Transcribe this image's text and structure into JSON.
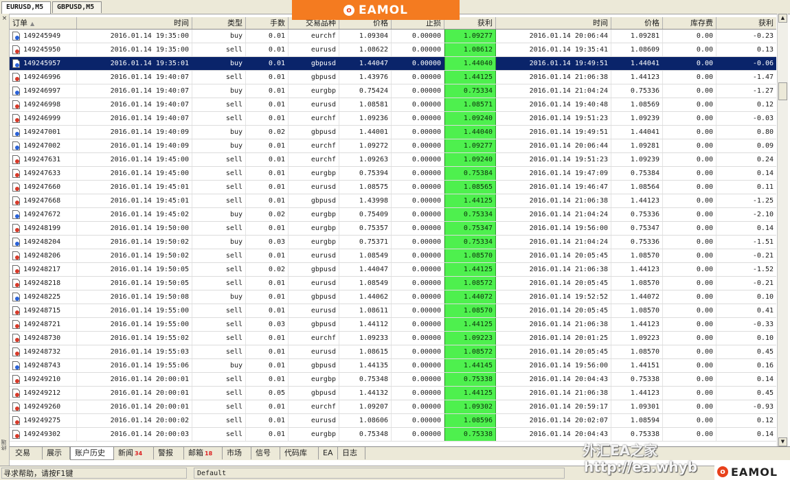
{
  "chart_tabs": [
    "EURUSD,M5",
    "GBPUSD,M5"
  ],
  "logo": {
    "text": "EAMOL",
    "mark": "o"
  },
  "left_strip": {
    "close": "×",
    "text": "终端"
  },
  "columns": [
    "订单",
    "时间",
    "类型",
    "手数",
    "交易品种",
    "价格",
    "止损",
    "获利",
    "时间",
    "价格",
    "库存费",
    "获利"
  ],
  "rows": [
    {
      "order": "149245949",
      "time": "2016.01.14 19:35:00",
      "type": "buy",
      "lots": "0.01",
      "symbol": "eurchf",
      "price": "1.09304",
      "sl": "0.00000",
      "tp": "1.09277",
      "close_time": "2016.01.14 20:06:44",
      "close_price": "1.09281",
      "swap": "0.00",
      "profit": "-0.23"
    },
    {
      "order": "149245950",
      "time": "2016.01.14 19:35:00",
      "type": "sell",
      "lots": "0.01",
      "symbol": "eurusd",
      "price": "1.08622",
      "sl": "0.00000",
      "tp": "1.08612",
      "close_time": "2016.01.14 19:35:41",
      "close_price": "1.08609",
      "swap": "0.00",
      "profit": "0.13"
    },
    {
      "order": "149245957",
      "time": "2016.01.14 19:35:01",
      "type": "buy",
      "lots": "0.01",
      "symbol": "gbpusd",
      "price": "1.44047",
      "sl": "0.00000",
      "tp": "1.44040",
      "close_time": "2016.01.14 19:49:51",
      "close_price": "1.44041",
      "swap": "0.00",
      "profit": "-0.06",
      "selected": true
    },
    {
      "order": "149246996",
      "time": "2016.01.14 19:40:07",
      "type": "sell",
      "lots": "0.01",
      "symbol": "gbpusd",
      "price": "1.43976",
      "sl": "0.00000",
      "tp": "1.44125",
      "close_time": "2016.01.14 21:06:38",
      "close_price": "1.44123",
      "swap": "0.00",
      "profit": "-1.47"
    },
    {
      "order": "149246997",
      "time": "2016.01.14 19:40:07",
      "type": "buy",
      "lots": "0.01",
      "symbol": "eurgbp",
      "price": "0.75424",
      "sl": "0.00000",
      "tp": "0.75334",
      "close_time": "2016.01.14 21:04:24",
      "close_price": "0.75336",
      "swap": "0.00",
      "profit": "-1.27"
    },
    {
      "order": "149246998",
      "time": "2016.01.14 19:40:07",
      "type": "sell",
      "lots": "0.01",
      "symbol": "eurusd",
      "price": "1.08581",
      "sl": "0.00000",
      "tp": "1.08571",
      "close_time": "2016.01.14 19:40:48",
      "close_price": "1.08569",
      "swap": "0.00",
      "profit": "0.12"
    },
    {
      "order": "149246999",
      "time": "2016.01.14 19:40:07",
      "type": "sell",
      "lots": "0.01",
      "symbol": "eurchf",
      "price": "1.09236",
      "sl": "0.00000",
      "tp": "1.09240",
      "close_time": "2016.01.14 19:51:23",
      "close_price": "1.09239",
      "swap": "0.00",
      "profit": "-0.03"
    },
    {
      "order": "149247001",
      "time": "2016.01.14 19:40:09",
      "type": "buy",
      "lots": "0.02",
      "symbol": "gbpusd",
      "price": "1.44001",
      "sl": "0.00000",
      "tp": "1.44040",
      "close_time": "2016.01.14 19:49:51",
      "close_price": "1.44041",
      "swap": "0.00",
      "profit": "0.80"
    },
    {
      "order": "149247002",
      "time": "2016.01.14 19:40:09",
      "type": "buy",
      "lots": "0.01",
      "symbol": "eurchf",
      "price": "1.09272",
      "sl": "0.00000",
      "tp": "1.09277",
      "close_time": "2016.01.14 20:06:44",
      "close_price": "1.09281",
      "swap": "0.00",
      "profit": "0.09"
    },
    {
      "order": "149247631",
      "time": "2016.01.14 19:45:00",
      "type": "sell",
      "lots": "0.01",
      "symbol": "eurchf",
      "price": "1.09263",
      "sl": "0.00000",
      "tp": "1.09240",
      "close_time": "2016.01.14 19:51:23",
      "close_price": "1.09239",
      "swap": "0.00",
      "profit": "0.24"
    },
    {
      "order": "149247633",
      "time": "2016.01.14 19:45:00",
      "type": "sell",
      "lots": "0.01",
      "symbol": "eurgbp",
      "price": "0.75394",
      "sl": "0.00000",
      "tp": "0.75384",
      "close_time": "2016.01.14 19:47:09",
      "close_price": "0.75384",
      "swap": "0.00",
      "profit": "0.14"
    },
    {
      "order": "149247660",
      "time": "2016.01.14 19:45:01",
      "type": "sell",
      "lots": "0.01",
      "symbol": "eurusd",
      "price": "1.08575",
      "sl": "0.00000",
      "tp": "1.08565",
      "close_time": "2016.01.14 19:46:47",
      "close_price": "1.08564",
      "swap": "0.00",
      "profit": "0.11"
    },
    {
      "order": "149247668",
      "time": "2016.01.14 19:45:01",
      "type": "sell",
      "lots": "0.01",
      "symbol": "gbpusd",
      "price": "1.43998",
      "sl": "0.00000",
      "tp": "1.44125",
      "close_time": "2016.01.14 21:06:38",
      "close_price": "1.44123",
      "swap": "0.00",
      "profit": "-1.25"
    },
    {
      "order": "149247672",
      "time": "2016.01.14 19:45:02",
      "type": "buy",
      "lots": "0.02",
      "symbol": "eurgbp",
      "price": "0.75409",
      "sl": "0.00000",
      "tp": "0.75334",
      "close_time": "2016.01.14 21:04:24",
      "close_price": "0.75336",
      "swap": "0.00",
      "profit": "-2.10"
    },
    {
      "order": "149248199",
      "time": "2016.01.14 19:50:00",
      "type": "sell",
      "lots": "0.01",
      "symbol": "eurgbp",
      "price": "0.75357",
      "sl": "0.00000",
      "tp": "0.75347",
      "close_time": "2016.01.14 19:56:00",
      "close_price": "0.75347",
      "swap": "0.00",
      "profit": "0.14"
    },
    {
      "order": "149248204",
      "time": "2016.01.14 19:50:02",
      "type": "buy",
      "lots": "0.03",
      "symbol": "eurgbp",
      "price": "0.75371",
      "sl": "0.00000",
      "tp": "0.75334",
      "close_time": "2016.01.14 21:04:24",
      "close_price": "0.75336",
      "swap": "0.00",
      "profit": "-1.51"
    },
    {
      "order": "149248206",
      "time": "2016.01.14 19:50:02",
      "type": "sell",
      "lots": "0.01",
      "symbol": "eurusd",
      "price": "1.08549",
      "sl": "0.00000",
      "tp": "1.08570",
      "close_time": "2016.01.14 20:05:45",
      "close_price": "1.08570",
      "swap": "0.00",
      "profit": "-0.21"
    },
    {
      "order": "149248217",
      "time": "2016.01.14 19:50:05",
      "type": "sell",
      "lots": "0.02",
      "symbol": "gbpusd",
      "price": "1.44047",
      "sl": "0.00000",
      "tp": "1.44125",
      "close_time": "2016.01.14 21:06:38",
      "close_price": "1.44123",
      "swap": "0.00",
      "profit": "-1.52"
    },
    {
      "order": "149248218",
      "time": "2016.01.14 19:50:05",
      "type": "sell",
      "lots": "0.01",
      "symbol": "eurusd",
      "price": "1.08549",
      "sl": "0.00000",
      "tp": "1.08572",
      "close_time": "2016.01.14 20:05:45",
      "close_price": "1.08570",
      "swap": "0.00",
      "profit": "-0.21"
    },
    {
      "order": "149248225",
      "time": "2016.01.14 19:50:08",
      "type": "buy",
      "lots": "0.01",
      "symbol": "gbpusd",
      "price": "1.44062",
      "sl": "0.00000",
      "tp": "1.44072",
      "close_time": "2016.01.14 19:52:52",
      "close_price": "1.44072",
      "swap": "0.00",
      "profit": "0.10"
    },
    {
      "order": "149248715",
      "time": "2016.01.14 19:55:00",
      "type": "sell",
      "lots": "0.01",
      "symbol": "eurusd",
      "price": "1.08611",
      "sl": "0.00000",
      "tp": "1.08570",
      "close_time": "2016.01.14 20:05:45",
      "close_price": "1.08570",
      "swap": "0.00",
      "profit": "0.41"
    },
    {
      "order": "149248721",
      "time": "2016.01.14 19:55:00",
      "type": "sell",
      "lots": "0.03",
      "symbol": "gbpusd",
      "price": "1.44112",
      "sl": "0.00000",
      "tp": "1.44125",
      "close_time": "2016.01.14 21:06:38",
      "close_price": "1.44123",
      "swap": "0.00",
      "profit": "-0.33"
    },
    {
      "order": "149248730",
      "time": "2016.01.14 19:55:02",
      "type": "sell",
      "lots": "0.01",
      "symbol": "eurchf",
      "price": "1.09233",
      "sl": "0.00000",
      "tp": "1.09223",
      "close_time": "2016.01.14 20:01:25",
      "close_price": "1.09223",
      "swap": "0.00",
      "profit": "0.10"
    },
    {
      "order": "149248732",
      "time": "2016.01.14 19:55:03",
      "type": "sell",
      "lots": "0.01",
      "symbol": "eurusd",
      "price": "1.08615",
      "sl": "0.00000",
      "tp": "1.08572",
      "close_time": "2016.01.14 20:05:45",
      "close_price": "1.08570",
      "swap": "0.00",
      "profit": "0.45"
    },
    {
      "order": "149248743",
      "time": "2016.01.14 19:55:06",
      "type": "buy",
      "lots": "0.01",
      "symbol": "gbpusd",
      "price": "1.44135",
      "sl": "0.00000",
      "tp": "1.44145",
      "close_time": "2016.01.14 19:56:00",
      "close_price": "1.44151",
      "swap": "0.00",
      "profit": "0.16"
    },
    {
      "order": "149249210",
      "time": "2016.01.14 20:00:01",
      "type": "sell",
      "lots": "0.01",
      "symbol": "eurgbp",
      "price": "0.75348",
      "sl": "0.00000",
      "tp": "0.75338",
      "close_time": "2016.01.14 20:04:43",
      "close_price": "0.75338",
      "swap": "0.00",
      "profit": "0.14"
    },
    {
      "order": "149249212",
      "time": "2016.01.14 20:00:01",
      "type": "sell",
      "lots": "0.05",
      "symbol": "gbpusd",
      "price": "1.44132",
      "sl": "0.00000",
      "tp": "1.44125",
      "close_time": "2016.01.14 21:06:38",
      "close_price": "1.44123",
      "swap": "0.00",
      "profit": "0.45"
    },
    {
      "order": "149249260",
      "time": "2016.01.14 20:00:01",
      "type": "sell",
      "lots": "0.01",
      "symbol": "eurchf",
      "price": "1.09207",
      "sl": "0.00000",
      "tp": "1.09302",
      "close_time": "2016.01.14 20:59:17",
      "close_price": "1.09301",
      "swap": "0.00",
      "profit": "-0.93"
    },
    {
      "order": "149249275",
      "time": "2016.01.14 20:00:02",
      "type": "sell",
      "lots": "0.01",
      "symbol": "eurusd",
      "price": "1.08606",
      "sl": "0.00000",
      "tp": "1.08596",
      "close_time": "2016.01.14 20:02:07",
      "close_price": "1.08594",
      "swap": "0.00",
      "profit": "0.12"
    },
    {
      "order": "149249302",
      "time": "2016.01.14 20:00:03",
      "type": "sell",
      "lots": "0.01",
      "symbol": "eurgbp",
      "price": "0.75348",
      "sl": "0.00000",
      "tp": "0.75338",
      "close_time": "2016.01.14 20:04:43",
      "close_price": "0.75338",
      "swap": "0.00",
      "profit": "0.14"
    }
  ],
  "bottom_tabs": [
    {
      "label": "交易"
    },
    {
      "label": "展示"
    },
    {
      "label": "账户历史",
      "active": true
    },
    {
      "label": "新闻",
      "badge": "34"
    },
    {
      "label": "警报"
    },
    {
      "label": "邮箱",
      "badge": "18"
    },
    {
      "label": "市场"
    },
    {
      "label": "信号"
    },
    {
      "label": "代码库"
    },
    {
      "label": "EA"
    },
    {
      "label": "日志"
    }
  ],
  "status": {
    "help": "寻求帮助，请按F1键",
    "profile": "Default"
  },
  "watermark": {
    "cn": "外汇EA之家",
    "url": "http://ea.whyb",
    "logo": "EAMOL"
  },
  "colors": {
    "selected_row": "#0a246a",
    "profit_highlight": "#4ef04e",
    "logo_orange": "#f47b20"
  }
}
